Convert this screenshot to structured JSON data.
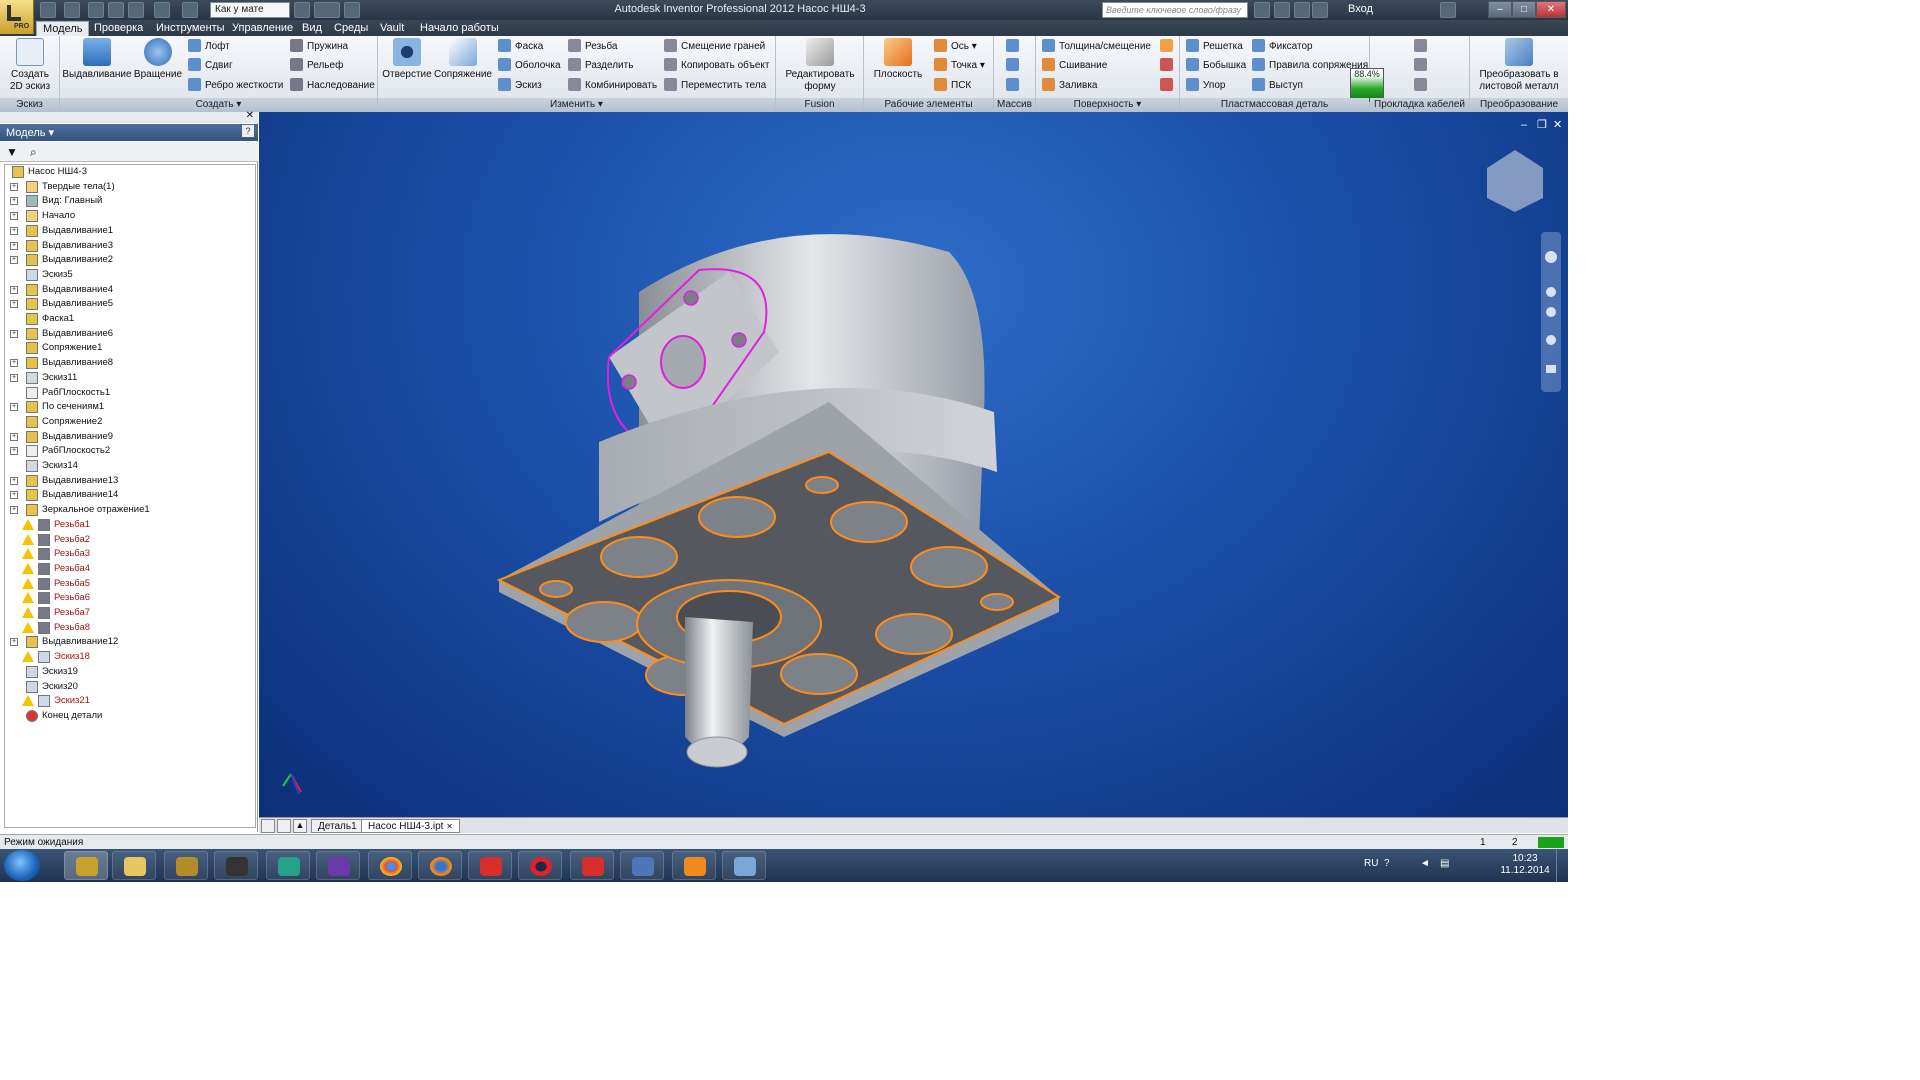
{
  "window": {
    "title": "Autodesk Inventor Professional 2012   Насос НШ4-3",
    "search_placeholder": "Введите ключевое слово/фразу",
    "login": "Вход",
    "appearance_combo": "Как у мате",
    "pro_label": "PRO"
  },
  "tabs": [
    "Модель",
    "Проверка",
    "Инструменты",
    "Управление",
    "Вид",
    "Среды",
    "Vault",
    "Начало работы"
  ],
  "panels": {
    "sketch": {
      "label": "Эскиз",
      "create2d": "Создать\n2D эскиз"
    },
    "create": {
      "label": "Создать",
      "extrude": "Выдавливание",
      "revolve": "Вращение",
      "loft": "Лофт",
      "sweep": "Сдвиг",
      "rib": "Ребро жесткости",
      "coil": "Пружина",
      "emboss": "Рельеф",
      "derive": "Наследование"
    },
    "modify": {
      "label": "Изменить",
      "hole": "Отверстие",
      "fillet": "Сопряжение",
      "chamfer": "Фаска",
      "shell": "Оболочка",
      "draft": "Эскиз",
      "thread": "Резьба",
      "split": "Разделить",
      "combine": "Комбинировать",
      "direct": "Смещение граней",
      "copy": "Копировать объект",
      "move": "Переместить тела"
    },
    "fusion": {
      "label": "Fusion",
      "edit": "Редактировать\nформу"
    },
    "work": {
      "label": "Рабочие элементы",
      "plane": "Плоскость",
      "axis": "Ось",
      "point": "Точка",
      "ucs": "ПСК"
    },
    "pattern": {
      "label": "Массив"
    },
    "surface": {
      "label": "Поверхность",
      "thicken": "Толщина/смещение",
      "stitch": "Сшивание",
      "patch": "Заливка"
    },
    "plastic": {
      "label": "Пластмассовая деталь",
      "grill": "Решетка",
      "boss": "Бобышка",
      "rest": "Упор",
      "snap": "Фиксатор",
      "rule": "Правила сопряжения",
      "lip": "Выступ",
      "percent": "88.4%"
    },
    "cable": {
      "label": "Прокладка кабелей"
    },
    "convert": {
      "label": "Преобразование",
      "sheetmetal": "Преобразовать в\nлистовой металл"
    }
  },
  "browser": {
    "header": "Модель",
    "tree": [
      {
        "t": "Насос НШ4-3",
        "ic": "part",
        "lv": 0,
        "exp": false
      },
      {
        "t": "Твердые тела(1)",
        "ic": "folder",
        "lv": 1,
        "exp": true
      },
      {
        "t": "Вид: Главный",
        "ic": "view",
        "lv": 1,
        "exp": true
      },
      {
        "t": "Начало",
        "ic": "folder",
        "lv": 1,
        "exp": true
      },
      {
        "t": "Выдавливание1",
        "ic": "ext",
        "lv": 1,
        "exp": true
      },
      {
        "t": "Выдавливание3",
        "ic": "ext",
        "lv": 1,
        "exp": true
      },
      {
        "t": "Выдавливание2",
        "ic": "ext",
        "lv": 1,
        "exp": true
      },
      {
        "t": "Эскиз5",
        "ic": "sketch",
        "lv": 1,
        "exp": false
      },
      {
        "t": "Выдавливание4",
        "ic": "ext",
        "lv": 1,
        "exp": true
      },
      {
        "t": "Выдавливание5",
        "ic": "ext",
        "lv": 1,
        "exp": true
      },
      {
        "t": "Фаска1",
        "ic": "fil",
        "lv": 1,
        "exp": false
      },
      {
        "t": "Выдавливание6",
        "ic": "ext",
        "lv": 1,
        "exp": true
      },
      {
        "t": "Сопряжение1",
        "ic": "fil",
        "lv": 1,
        "exp": false
      },
      {
        "t": "Выдавливание8",
        "ic": "ext",
        "lv": 1,
        "exp": true
      },
      {
        "t": "Эскиз11",
        "ic": "sketch",
        "lv": 1,
        "exp": true
      },
      {
        "t": "РабПлоскость1",
        "ic": "plane",
        "lv": 1,
        "exp": false
      },
      {
        "t": "По сечениям1",
        "ic": "ext",
        "lv": 1,
        "exp": true
      },
      {
        "t": "Сопряжение2",
        "ic": "fil",
        "lv": 1,
        "exp": false
      },
      {
        "t": "Выдавливание9",
        "ic": "ext",
        "lv": 1,
        "exp": true
      },
      {
        "t": "РабПлоскость2",
        "ic": "plane",
        "lv": 1,
        "exp": true
      },
      {
        "t": "Эскиз14",
        "ic": "sketch",
        "lv": 1,
        "exp": false
      },
      {
        "t": "Выдавливание13",
        "ic": "ext",
        "lv": 1,
        "exp": true
      },
      {
        "t": "Выдавливание14",
        "ic": "ext",
        "lv": 1,
        "exp": true
      },
      {
        "t": "Зеркальное отражение1",
        "ic": "mirror",
        "lv": 1,
        "exp": true
      },
      {
        "t": "Резьба1",
        "ic": "thread",
        "lv": 1,
        "exp": false,
        "err": true
      },
      {
        "t": "Резьба2",
        "ic": "thread",
        "lv": 1,
        "exp": false,
        "err": true
      },
      {
        "t": "Резьба3",
        "ic": "thread",
        "lv": 1,
        "exp": false,
        "err": true
      },
      {
        "t": "Резьба4",
        "ic": "thread",
        "lv": 1,
        "exp": false,
        "err": true
      },
      {
        "t": "Резьба5",
        "ic": "thread",
        "lv": 1,
        "exp": false,
        "err": true
      },
      {
        "t": "Резьба6",
        "ic": "thread",
        "lv": 1,
        "exp": false,
        "err": true
      },
      {
        "t": "Резьба7",
        "ic": "thread",
        "lv": 1,
        "exp": false,
        "err": true
      },
      {
        "t": "Резьба8",
        "ic": "thread",
        "lv": 1,
        "exp": false,
        "err": true
      },
      {
        "t": "Выдавливание12",
        "ic": "ext",
        "lv": 1,
        "exp": true
      },
      {
        "t": "Эскиз18",
        "ic": "sketch",
        "lv": 1,
        "exp": false,
        "err": true
      },
      {
        "t": "Эскиз19",
        "ic": "sketch",
        "lv": 1,
        "exp": false
      },
      {
        "t": "Эскиз20",
        "ic": "sketch",
        "lv": 1,
        "exp": false
      },
      {
        "t": "Эскиз21",
        "ic": "sketch",
        "lv": 1,
        "exp": false,
        "err": true
      },
      {
        "t": "Конец детали",
        "ic": "end",
        "lv": 1,
        "exp": false
      }
    ]
  },
  "doctabs": [
    "Деталь1",
    "Насос НШ4-3.ipt"
  ],
  "status": {
    "text": "Режим ожидания",
    "n1": "1",
    "n2": "2"
  },
  "taskbar": {
    "lang": "RU",
    "time": "10:23",
    "date": "11.12.2014"
  },
  "colors": {
    "accent": "#2b5797",
    "edge_orange": "#ff8c1a",
    "edge_magenta": "#e020e0",
    "viewport": "#1b4fa8"
  }
}
